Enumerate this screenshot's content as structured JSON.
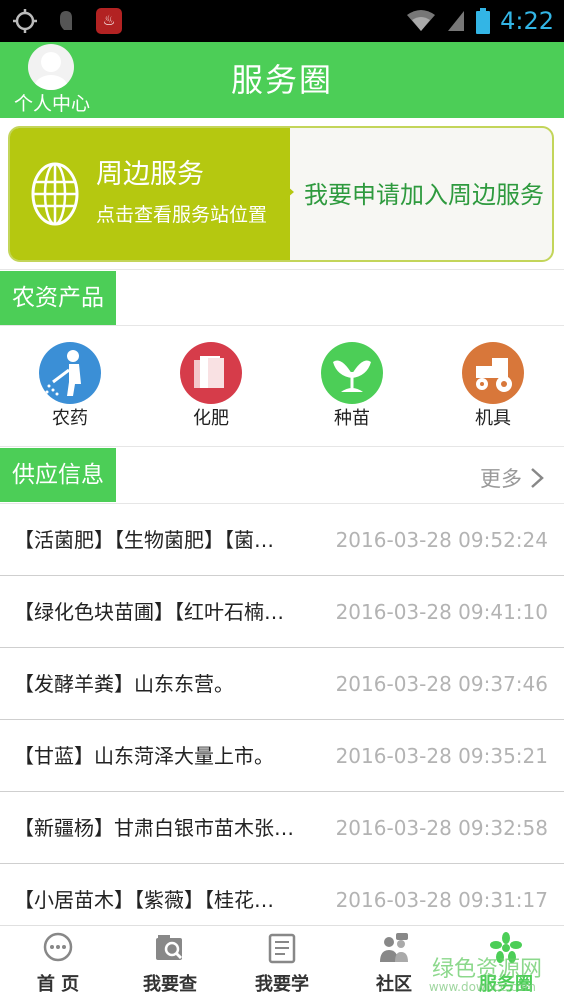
{
  "status_bar": {
    "time": "4:22",
    "icons": [
      "crosshair-icon",
      "hand-icon",
      "app-badge-icon",
      "wifi-icon",
      "signal-icon",
      "battery-icon"
    ]
  },
  "header": {
    "avatar_label": "个人中心",
    "title": "服务圈"
  },
  "banner": {
    "title": "周边服务",
    "subtitle": "点击查看服务站位置",
    "join_text": "我要申请加入周边服务 »"
  },
  "products": {
    "section_title": "农资产品",
    "items": [
      {
        "label": "农药",
        "icon": "sprayer-icon",
        "color": "#3b8fd6"
      },
      {
        "label": "化肥",
        "icon": "fertilizer-bag-icon",
        "color": "#d63c4a"
      },
      {
        "label": "种苗",
        "icon": "seedling-icon",
        "color": "#4cce57"
      },
      {
        "label": "机具",
        "icon": "tractor-icon",
        "color": "#d8773a"
      }
    ]
  },
  "supply": {
    "section_title": "供应信息",
    "more_label": "更多",
    "rows": [
      {
        "title": "【活菌肥】【生物菌肥】【菌…",
        "time": "2016-03-28 09:52:24"
      },
      {
        "title": "【绿化色块苗圃】【红叶石楠…",
        "time": "2016-03-28 09:41:10"
      },
      {
        "title": "【发酵羊粪】山东东营。",
        "time": "2016-03-28 09:37:46"
      },
      {
        "title": "【甘蓝】山东菏泽大量上市。",
        "time": "2016-03-28 09:35:21"
      },
      {
        "title": "【新疆杨】甘肃白银市苗木张…",
        "time": "2016-03-28 09:32:58"
      },
      {
        "title": "【小居苗木】【紫薇】【桂花…",
        "time": "2016-03-28 09:31:17"
      }
    ]
  },
  "bottom_nav": [
    {
      "label": "首 页",
      "icon": "chat-bubble-icon"
    },
    {
      "label": "我要查",
      "icon": "search-folder-icon"
    },
    {
      "label": "我要学",
      "icon": "notebook-icon"
    },
    {
      "label": "社区",
      "icon": "community-icon"
    },
    {
      "label": "服务圈",
      "icon": "service-circle-icon"
    }
  ],
  "watermark": {
    "text": "绿色资源网",
    "sub": "www.downcc.com"
  },
  "colors": {
    "accent": "#4cce57",
    "banner": "#b5c810",
    "join_text": "#2e9a3e"
  }
}
